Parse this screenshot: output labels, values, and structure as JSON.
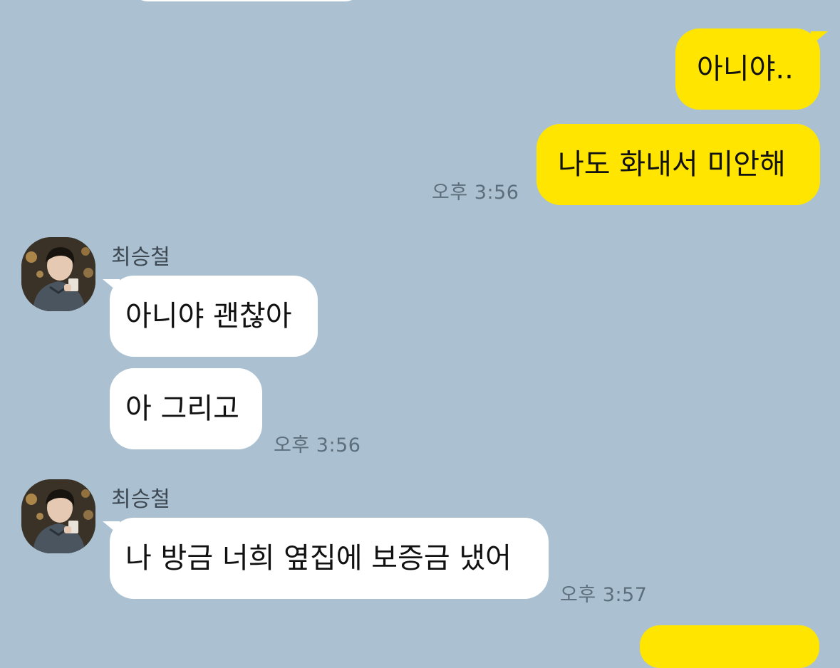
{
  "chat": {
    "messages": [
      {
        "id": 1,
        "side": "me",
        "text": "아니야..",
        "time": ""
      },
      {
        "id": 2,
        "side": "me",
        "text": "나도 화내서 미안해",
        "time": "오후 3:56"
      },
      {
        "id": 3,
        "side": "them",
        "sender": "최승철",
        "text": "아니야 괜찮아",
        "time": ""
      },
      {
        "id": 4,
        "side": "them",
        "text": "아 그리고",
        "time": "오후 3:56"
      },
      {
        "id": 5,
        "side": "them",
        "sender": "최승철",
        "text": "나 방금 너희 옆집에 보증금 냈어",
        "time": "오후 3:57"
      }
    ]
  },
  "colors": {
    "background": "#abc1d1",
    "my_bubble": "#ffe500",
    "their_bubble": "#ffffff",
    "timestamp": "#5d6e7c"
  },
  "icons": {
    "avatar": "profile-photo-avatar"
  }
}
